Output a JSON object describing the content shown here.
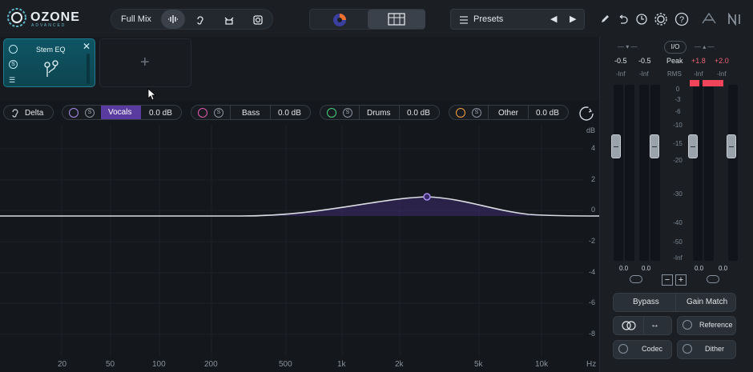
{
  "app": {
    "logo_word": "OZONE",
    "logo_sub": "ADVANCED"
  },
  "topbar": {
    "mode_label": "Full Mix",
    "presets_label": "Presets",
    "icons": [
      "waveform-icon",
      "ear-icon",
      "music-hat-icon",
      "speaker-icon",
      "pencil-icon",
      "undo-icon",
      "history-icon",
      "gear-icon",
      "help-icon",
      "bypass-logo-icon",
      "ni-logo-icon"
    ]
  },
  "module": {
    "name": "Stem EQ"
  },
  "stems": [
    {
      "name": "Delta",
      "color": "#9aa2ab"
    },
    {
      "name": "Vocals",
      "value": "0.0 dB",
      "color": "#a88cf0",
      "active": true
    },
    {
      "name": "Bass",
      "value": "0.0 dB",
      "color": "#e55bb0"
    },
    {
      "name": "Drums",
      "value": "0.0 dB",
      "color": "#45d17e"
    },
    {
      "name": "Other",
      "value": "0.0 dB",
      "color": "#f0a040"
    }
  ],
  "eq": {
    "y_unit": "dB",
    "y_labels": [
      "4",
      "2",
      "0",
      "-2",
      "-4",
      "-6",
      "-8"
    ],
    "x_labels": [
      "20",
      "50",
      "100",
      "200",
      "500",
      "1k",
      "2k",
      "5k",
      "10k",
      "Hz"
    ],
    "node_color": "#8b6ff0"
  },
  "meter": {
    "in_peak": [
      "-0.5",
      "-0.5"
    ],
    "in_rms": [
      "-Inf",
      "-Inf"
    ],
    "io_label": "I/O",
    "peak_label": "Peak",
    "rms_label": "RMS",
    "out_peak": [
      "+1.8",
      "+2.0"
    ],
    "out_rms": [
      "-Inf",
      "-Inf"
    ],
    "scale": [
      "0",
      "-3",
      "-6",
      "-10",
      "-15",
      "-20",
      "-30",
      "-40",
      "-50",
      "-Inf"
    ],
    "in_gain": [
      "0.0",
      "0.0"
    ],
    "out_gain": [
      "0.0",
      "0.0"
    ],
    "bypass_label": "Bypass",
    "gain_match_label": "Gain Match",
    "reference_label": "Reference",
    "codec_label": "Codec",
    "dither_label": "Dither"
  }
}
